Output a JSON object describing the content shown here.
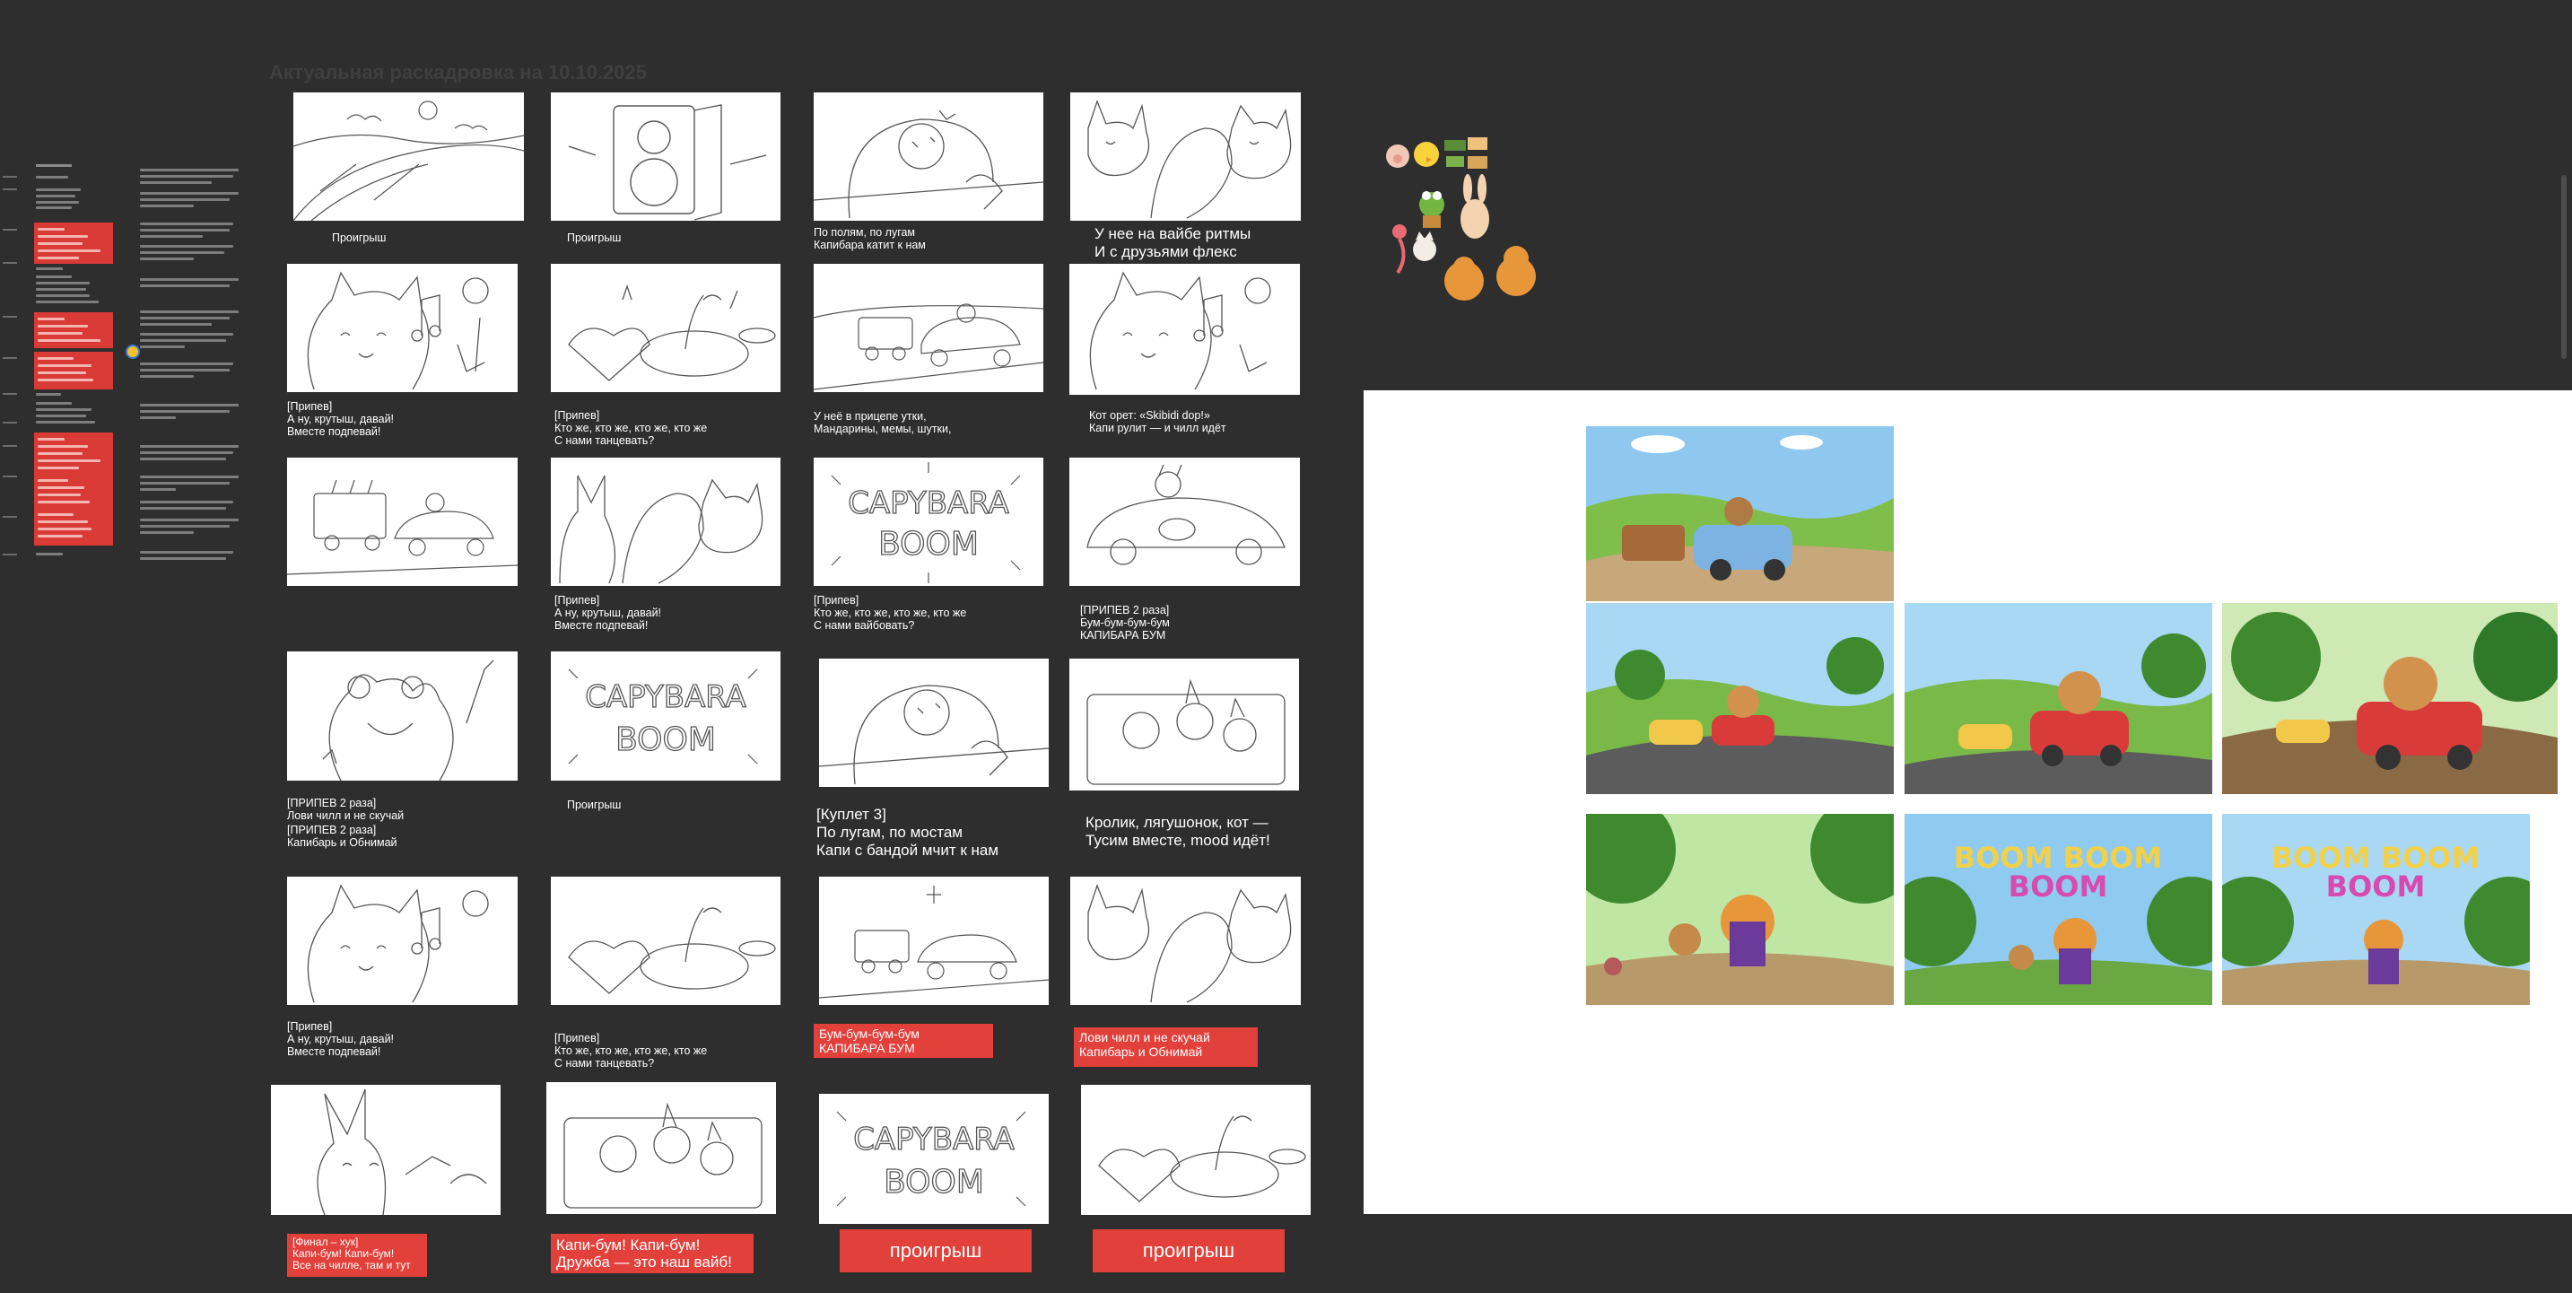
{
  "board": {
    "title": "Актуальная раскадровка на 10.10.2025"
  },
  "captions": {
    "r1c1": "Проигрыш",
    "r1c2": "Проигрыш",
    "r1c3": "По полям, по лугам\nКапибара катит к нам",
    "r1c4": "У нее на вайбе ритмы\nИ с друзьями флекс",
    "r2c1": "[Припев]\nА ну, крутыш, давай!\nВместе подпевай!",
    "r2c2": "[Припев]\nКто же, кто же, кто же, кто же\nС нами танцевать?",
    "r2c3": "У неё в прицепе утки,\nМандарины, мемы, шутки,",
    "r2c4": "Кот орет: «Skibidi dop!»\nКапи рулит — и чилл идёт",
    "r3c2": "[Припев]\nА ну, крутыш, давай!\nВместе подпевай!",
    "r3c3": "[Припев]\nКто же, кто же, кто же, кто же\nС нами вайбовать?",
    "r3c4": "[ПРИПЕВ 2 раза]\nБум-бум-бум-бум\nКАПИБАРА БУМ",
    "r4c1a": "[ПРИПЕВ 2 раза]\nЛови чилл и не скучай",
    "r4c1b": "[ПРИПЕВ 2 раза]\nКапибарь и Обнимай",
    "r4c2": "Проигрыш",
    "r4c3": "[Куплет 3]\nПо лугам, по мостам\nКапи с бандой мчит к нам",
    "r4c4": "Кролик, лягушонок, кот —\nТусим вместе, mood идёт!",
    "r5c1": "[Припев]\nА ну, крутыш, давай!\nВместе подпевай!",
    "r5c2": "[Припев]\nКто же, кто же, кто же, кто же\nС нами танцевать?",
    "r5c3": "Бум-бум-бум-бум\nКАПИБАРА БУМ",
    "r5c4": "Лови чилл и не скучай\nКапибарь и Обнимай",
    "r6c1": "[Финал – хук]\nКапи-бум! Капи-бум!\nВсе на чилле, там и тут",
    "r6c2": "Капи-бум! Капи-бум!\nДружба — это наш вайб!",
    "r6c3": "проигрыш",
    "r6c4": "проигрыш"
  },
  "sketch_texts": {
    "boom_line1": "CAPYBARA",
    "boom_line2": "BOOM"
  },
  "renders": {
    "boom_line1": "BOOM BOOM",
    "boom_line2": "BOOM"
  },
  "colors": {
    "board_bg": "#2e2e2e",
    "accent_red": "#e2403b",
    "canvas": "#ffffff"
  }
}
